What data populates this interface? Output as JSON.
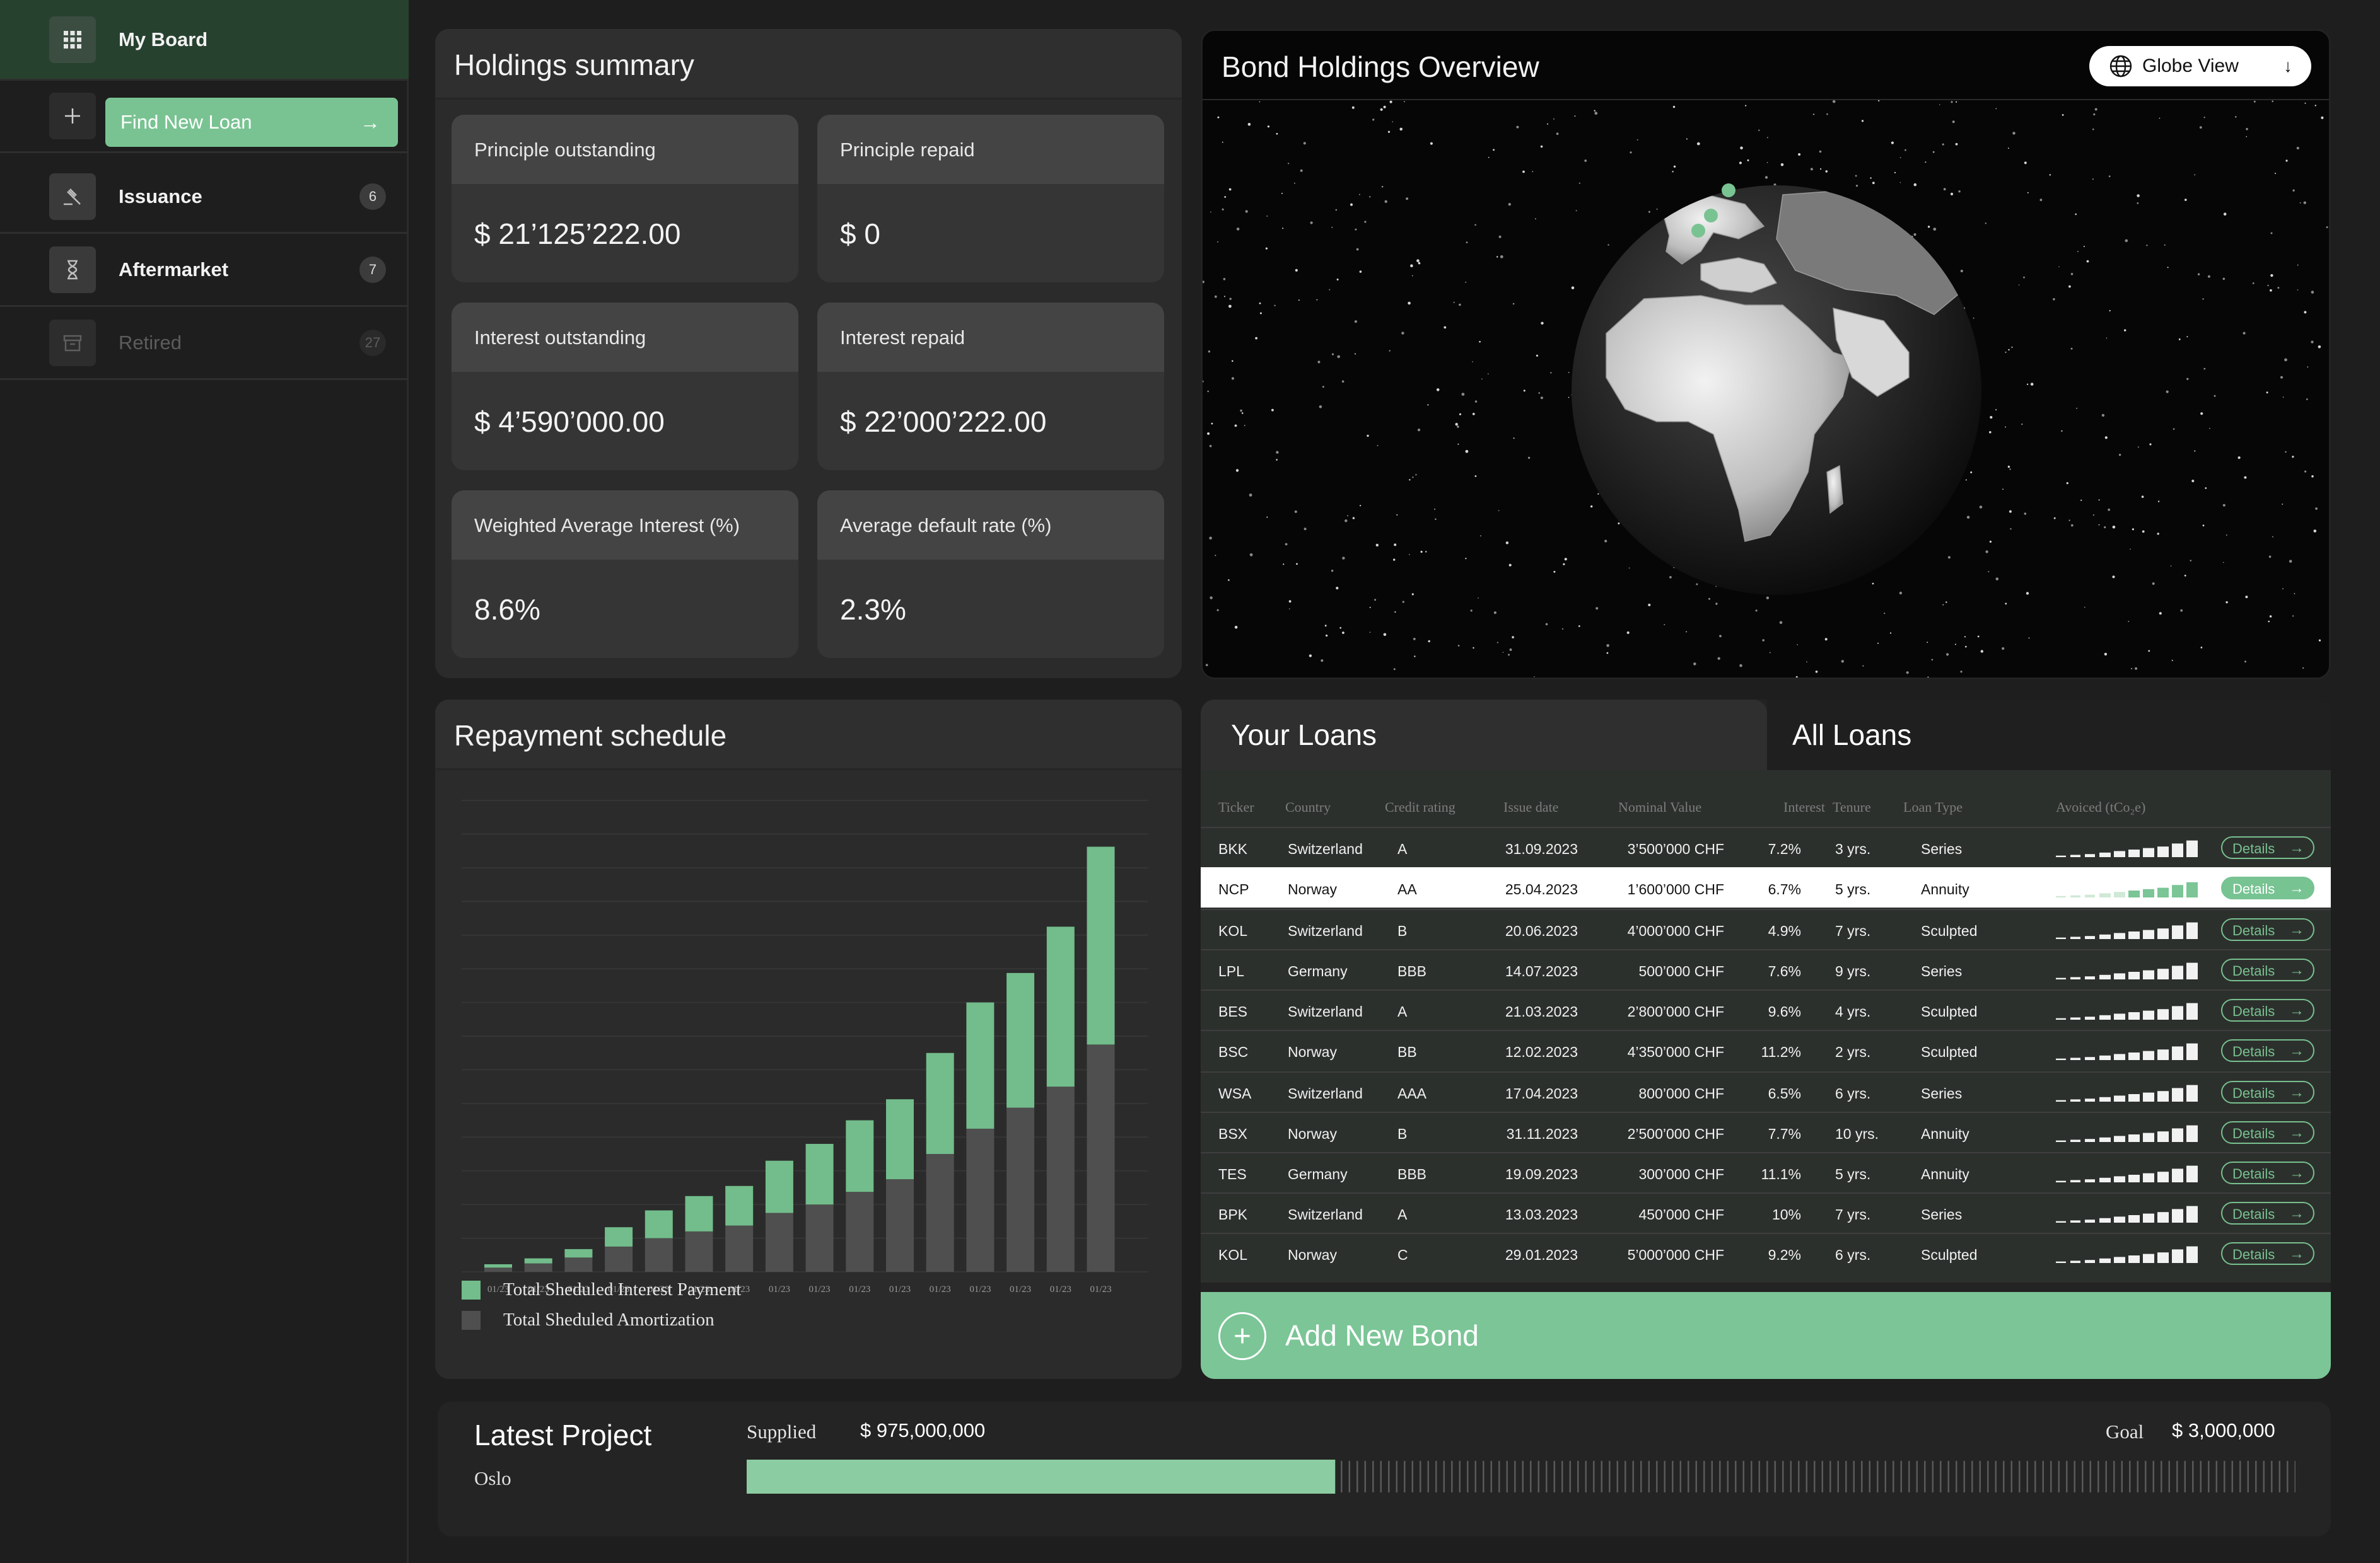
{
  "sidebar": {
    "board_label": "My Board",
    "find_loan_label": "Find New Loan",
    "items": [
      {
        "label": "Issuance",
        "count": "6"
      },
      {
        "label": "Aftermarket",
        "count": "7"
      },
      {
        "label": "Retired",
        "count": "27"
      }
    ]
  },
  "holdings": {
    "title": "Holdings summary",
    "cards": [
      {
        "label": "Principle outstanding",
        "value": "$ 21’125’222.00"
      },
      {
        "label": "Principle repaid",
        "value": "$ 0"
      },
      {
        "label": "Interest outstanding",
        "value": "$ 4’590’000.00"
      },
      {
        "label": "Interest repaid",
        "value": "$ 22’000’222.00"
      },
      {
        "label": "Weighted Average Interest (%)",
        "value": "8.6%"
      },
      {
        "label": "Average default rate (%)",
        "value": "2.3%"
      }
    ]
  },
  "globe": {
    "title": "Bond Holdings Overview",
    "view_label": "Globe View"
  },
  "repayment": {
    "title": "Repayment schedule",
    "legend": [
      "Total Sheduled Interest Payment",
      "Total Sheduled Amortization"
    ]
  },
  "chart_data": {
    "type": "bar",
    "stacked": true,
    "categories": [
      "01/23",
      "01/23",
      "01/23",
      "01/23",
      "01/23",
      "01/23",
      "01/23",
      "01/23",
      "01/23",
      "01/23",
      "01/23",
      "01/23",
      "01/23",
      "01/23",
      "01/23",
      "01/23"
    ],
    "series": [
      {
        "name": "Total Sheduled Amortization",
        "color": "#4f4f4f",
        "values": [
          0.5,
          1,
          1.7,
          3,
          4,
          4.8,
          5.5,
          7,
          8,
          9.5,
          11,
          14,
          17,
          19.5,
          22,
          27
        ]
      },
      {
        "name": "Total Sheduled Interest Payment",
        "color": "#72bd8b",
        "values": [
          0.4,
          0.6,
          1.0,
          2.3,
          3.3,
          4.2,
          4.7,
          6.2,
          7.2,
          8.5,
          9.5,
          12,
          15,
          16,
          19,
          23.5
        ]
      }
    ],
    "ylim": [
      0,
      56
    ],
    "grid": true,
    "legend_position": "bottom-left"
  },
  "loans": {
    "tab_your": "Your Loans",
    "tab_all": "All Loans",
    "columns": [
      "Ticker",
      "Country",
      "Credit rating",
      "Issue date",
      "Nominal Value",
      "Interest",
      "Tenure",
      "Loan Type",
      "Avoiced (tCo₂e)"
    ],
    "details_label": "Details",
    "selected_row": 1,
    "rows": [
      [
        "BKK",
        "Switzerland",
        "A",
        "31.09.2023",
        "3’500’000 CHF",
        "7.2%",
        "3 yrs.",
        "Series"
      ],
      [
        "NCP",
        "Norway",
        "AA",
        "25.04.2023",
        "1’600’000 CHF",
        "6.7%",
        "5 yrs.",
        "Annuity"
      ],
      [
        "KOL",
        "Switzerland",
        "B",
        "20.06.2023",
        "4’000’000 CHF",
        "4.9%",
        "7 yrs.",
        "Sculpted"
      ],
      [
        "LPL",
        "Germany",
        "BBB",
        "14.07.2023",
        "500’000 CHF",
        "7.6%",
        "9 yrs.",
        "Series"
      ],
      [
        "BES",
        "Switzerland",
        "A",
        "21.03.2023",
        "2’800’000 CHF",
        "9.6%",
        "4 yrs.",
        "Sculpted"
      ],
      [
        "BSC",
        "Norway",
        "BB",
        "12.02.2023",
        "4’350’000 CHF",
        "11.2%",
        "2 yrs.",
        "Sculpted"
      ],
      [
        "WSA",
        "Switzerland",
        "AAA",
        "17.04.2023",
        "800’000 CHF",
        "6.5%",
        "6 yrs.",
        "Series"
      ],
      [
        "BSX",
        "Norway",
        "B",
        "31.11.2023",
        "2’500’000 CHF",
        "7.7%",
        "10 yrs.",
        "Annuity"
      ],
      [
        "TES",
        "Germany",
        "BBB",
        "19.09.2023",
        "300’000 CHF",
        "11.1%",
        "5 yrs.",
        "Annuity"
      ],
      [
        "BPK",
        "Switzerland",
        "A",
        "13.03.2023",
        "450’000 CHF",
        "10%",
        "7 yrs.",
        "Series"
      ],
      [
        "KOL",
        "Norway",
        "C",
        "29.01.2023",
        "5’000’000 CHF",
        "9.2%",
        "6 yrs.",
        "Sculpted"
      ]
    ],
    "add_label": "Add New Bond"
  },
  "latest": {
    "title": "Latest Project",
    "city": "Oslo",
    "supplied_label": "Supplied",
    "supplied_value": "$ 975,000,000",
    "goal_label": "Goal",
    "goal_value": "$ 3,000,000",
    "progress_fraction": 0.38
  },
  "colors": {
    "accent": "#79c392",
    "background": "#1e1e1e",
    "panel": "#2b2b2b",
    "highlight_green": "#27412f"
  }
}
